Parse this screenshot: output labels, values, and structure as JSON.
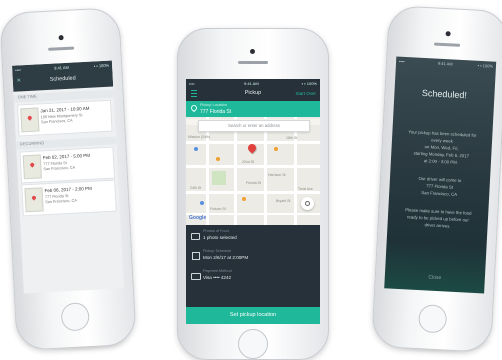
{
  "phone1": {
    "status": {
      "carrier": "•••• ",
      "time": "9:41 AM",
      "battery": "▪ ▪ 100%"
    },
    "nav": {
      "back_icon": "close-icon",
      "title": "Scheduled"
    },
    "sections": [
      {
        "label": "ONE TIME",
        "items": [
          {
            "date": "Jan 21, 2017 - 10:00 AM",
            "addr1": "180 New Montgomery St",
            "addr2": "San Francisco, CA"
          }
        ]
      },
      {
        "label": "RECURRING",
        "items": [
          {
            "date": "Feb 02, 2017 - 5:00 PM",
            "addr1": "777 Florida St",
            "addr2": "San Francisco, CA"
          },
          {
            "date": "Feb 06, 2017 - 2:00 PM",
            "addr1": "777 Florida St",
            "addr2": "San Francisco, CA"
          }
        ]
      }
    ]
  },
  "phone2": {
    "status": {
      "carrier": "•••• ",
      "time": "9:41 AM",
      "battery": "▪ ▪ 100%"
    },
    "nav": {
      "menu_icon": "hamburger-icon",
      "title": "Pickup",
      "right": "Start Over"
    },
    "location": {
      "label": "Pickup Location",
      "value": "777 Florida St"
    },
    "search": {
      "placeholder": "Search or enter an address"
    },
    "map": {
      "streets": [
        "Mission (24th)",
        "22nd St",
        "Harrison St",
        "Florida St",
        "Bryant St",
        "24th St",
        "18th St",
        "Folsom St",
        "Treat Ave"
      ],
      "google": "Google"
    },
    "details": [
      {
        "icon": "camera-icon",
        "label": "Photos of Food",
        "value": "1 photo selected"
      },
      {
        "icon": "calendar-icon",
        "label": "Pickup Schedule",
        "value": "Mon 2/6/17 at 2:00PM"
      },
      {
        "icon": "card-icon",
        "label": "Payment Method",
        "value": "Visa •••• 4242"
      }
    ],
    "cta": "Set pickup location",
    "colors": {
      "accent": "#1fb89a",
      "dark": "#26313a"
    }
  },
  "phone3": {
    "status": {
      "carrier": "•••• ",
      "time": "9:41 AM",
      "battery": "▪ ▪ 100%"
    },
    "title": "Scheduled!",
    "lines1": [
      "Your pickup has been scheduled for",
      "every week",
      "on Mon, Wed, Fri,",
      "starting Monday, Feb 6, 2017",
      "at 2:00 - 3:00 PM."
    ],
    "lines2": [
      "Our driver will come to",
      "777 Florida St",
      "San Francisco, CA"
    ],
    "lines3": [
      "Please make sure to have the food",
      "ready to be picked up before our",
      "driver arrives."
    ],
    "close": "Close"
  }
}
